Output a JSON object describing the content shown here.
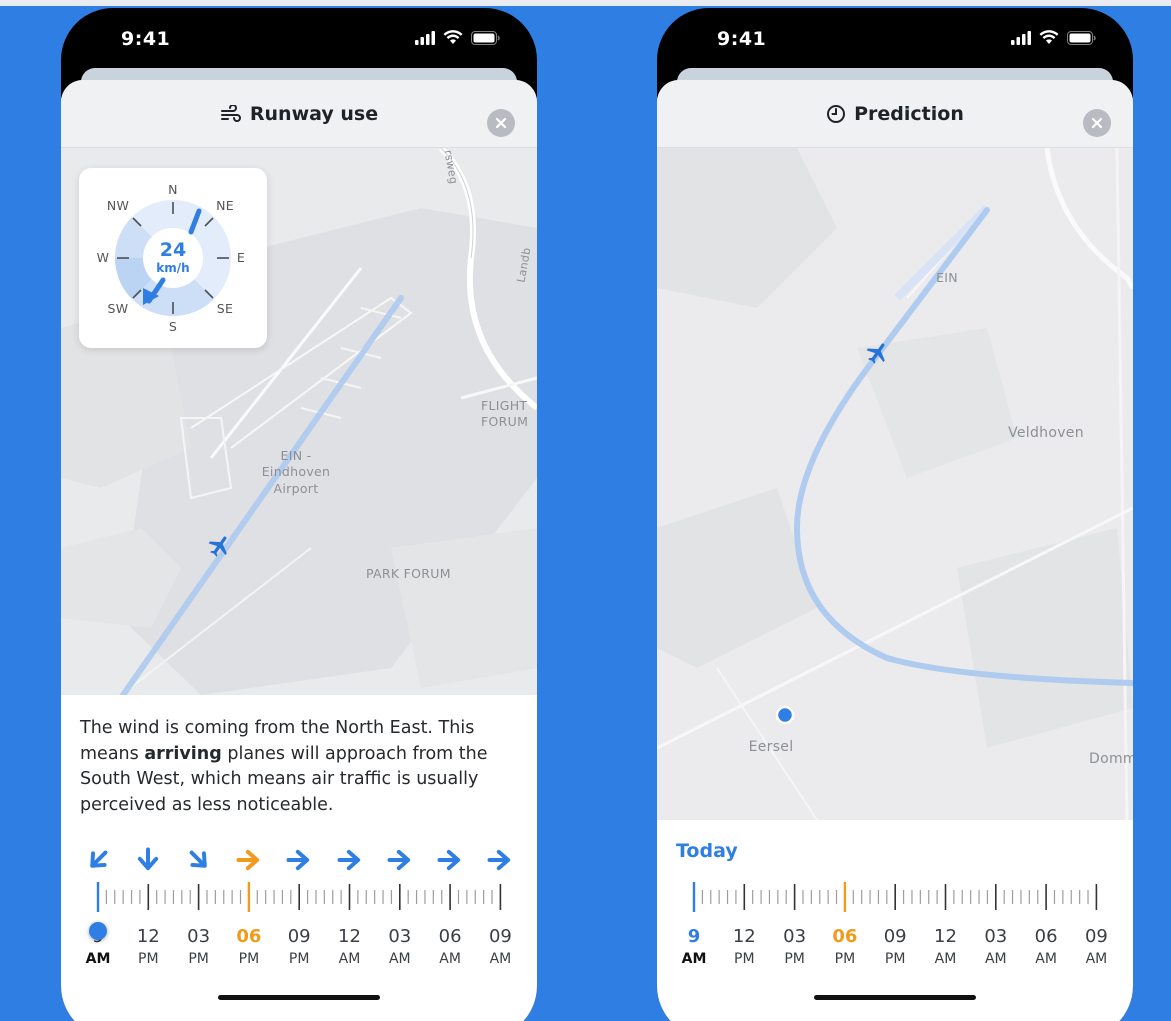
{
  "left_phone": {
    "status_time": "9:41",
    "title": "Runway use",
    "title_icon": "wind-icon",
    "compass": {
      "speed": "24",
      "unit": "km/h",
      "directions": [
        "N",
        "NE",
        "E",
        "SE",
        "S",
        "SW",
        "W",
        "NW"
      ]
    },
    "map_labels": {
      "airport": "EIN -\nEindhoven\nAirport",
      "flight_forum": "FLIGHT\nFORUM",
      "park_forum": "PARK FORUM",
      "road1": "rsweg",
      "road2": "Landb"
    },
    "description_prefix": "The wind is coming from the North East. This means ",
    "description_bold": "arriving",
    "description_suffix": " planes will approach from the South West, which means air traffic is usually perceived as less noticeable.",
    "timeline": {
      "arrow_directions": [
        "sw",
        "s",
        "se",
        "e",
        "e",
        "e",
        "e",
        "e",
        "e"
      ],
      "arrow_colors": [
        "#2f7ee3",
        "#2f7ee3",
        "#2f7ee3",
        "#f19a1c",
        "#2f7ee3",
        "#2f7ee3",
        "#2f7ee3",
        "#2f7ee3",
        "#2f7ee3"
      ],
      "labels": [
        {
          "num": "9",
          "ampm": "AM"
        },
        {
          "num": "12",
          "ampm": "PM"
        },
        {
          "num": "03",
          "ampm": "PM"
        },
        {
          "num": "06",
          "ampm": "PM"
        },
        {
          "num": "09",
          "ampm": "PM"
        },
        {
          "num": "12",
          "ampm": "AM"
        },
        {
          "num": "03",
          "ampm": "AM"
        },
        {
          "num": "06",
          "ampm": "AM"
        },
        {
          "num": "09",
          "ampm": "AM"
        }
      ]
    }
  },
  "right_phone": {
    "status_time": "9:41",
    "title": "Prediction",
    "title_icon": "clock-icon",
    "map_labels": {
      "ein": "EIN",
      "veldhoven": "Veldhoven",
      "eersel": "Eersel",
      "domm": "Domm"
    },
    "day_label": "Today",
    "timeline": {
      "labels": [
        {
          "num": "9",
          "ampm": "AM"
        },
        {
          "num": "12",
          "ampm": "PM"
        },
        {
          "num": "03",
          "ampm": "PM"
        },
        {
          "num": "06",
          "ampm": "PM"
        },
        {
          "num": "09",
          "ampm": "PM"
        },
        {
          "num": "12",
          "ampm": "AM"
        },
        {
          "num": "03",
          "ampm": "AM"
        },
        {
          "num": "06",
          "ampm": "AM"
        },
        {
          "num": "09",
          "ampm": "AM"
        }
      ]
    }
  },
  "colors": {
    "background": "#2f7ee3",
    "accent_blue": "#2f7ee3",
    "accent_orange": "#f19a1c",
    "flight_path": "#a9c8f0"
  }
}
